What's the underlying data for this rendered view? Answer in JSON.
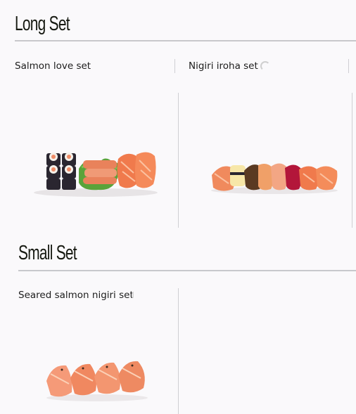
{
  "sections": [
    {
      "title": "Long Set",
      "items": [
        {
          "name": "Salmon love set",
          "image": "salmon-love-set-photo"
        },
        {
          "name": "Nigiri iroha set",
          "image": "nigiri-iroha-set-photo"
        }
      ]
    },
    {
      "title": "Small Set",
      "items": [
        {
          "name": "Seared salmon nigiri set",
          "image": "seared-salmon-nigiri-set-photo"
        }
      ]
    }
  ],
  "icons": {
    "loading": "loading-spinner-icon"
  },
  "colors": {
    "background": "#faf9fb",
    "divider": "#c8c8cc",
    "heading": "#171a12",
    "salmon": "#f08a5d",
    "nori": "#2a2630",
    "lettuce": "#5aa33a"
  }
}
